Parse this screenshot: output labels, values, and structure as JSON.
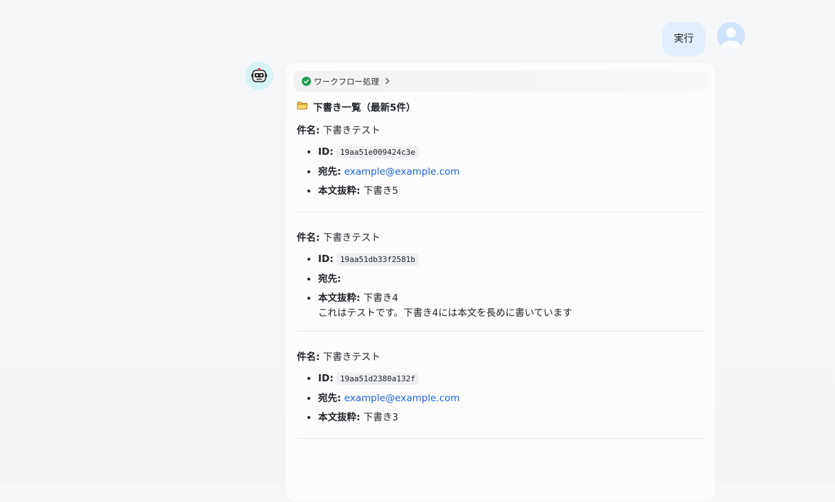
{
  "user_message": {
    "text": "実行"
  },
  "workflow": {
    "label": "ワークフロー処理"
  },
  "heading": {
    "text": "下書き一覧（最新5件）"
  },
  "labels": {
    "subject": "件名:",
    "id": "ID:",
    "to": "宛先:",
    "excerpt": "本文抜粋:"
  },
  "drafts": [
    {
      "subject": "下書きテスト",
      "id": "19aa51e009424c3e",
      "to": "example@example.com",
      "excerpt": "下書き5",
      "excerpt_extra": ""
    },
    {
      "subject": "下書きテスト",
      "id": "19aa51db33f2581b",
      "to": "",
      "excerpt": "下書き4",
      "excerpt_extra": "これはテストです。下書き4には本文を長めに書いています"
    },
    {
      "subject": "下書きテスト",
      "id": "19aa51d2380a132f",
      "to": "example@example.com",
      "excerpt": "下書き3",
      "excerpt_extra": ""
    }
  ],
  "colors": {
    "link": "#1a63d8",
    "user_bubble": "#e3eefd",
    "check": "#1f9d55"
  },
  "icons": {
    "workflow_status": "check-circle-icon",
    "chevron": "chevron-right-icon",
    "folder": "folder-icon"
  }
}
